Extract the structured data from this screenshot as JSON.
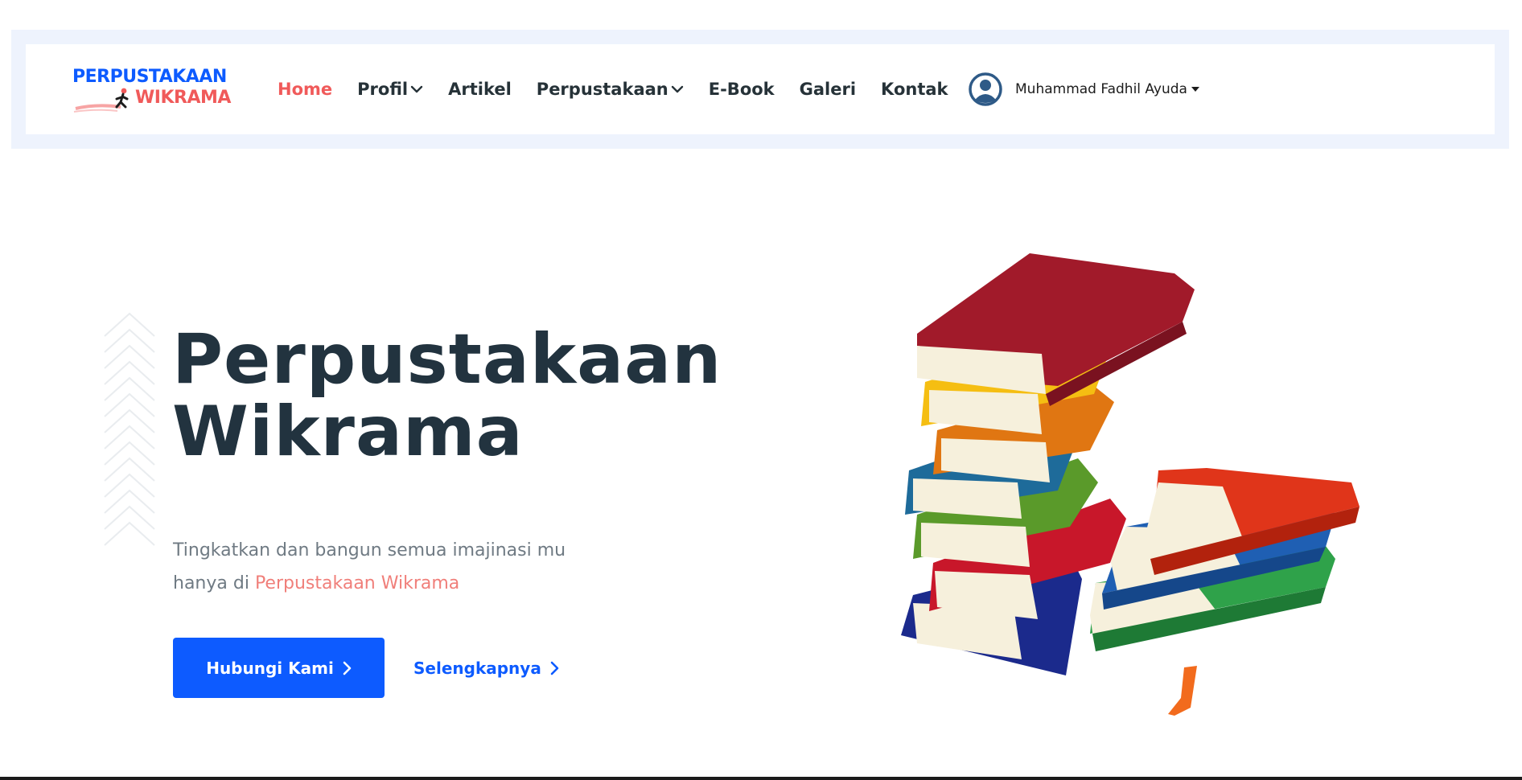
{
  "header": {
    "logo": {
      "line1": "PERPUSTAKAAN",
      "line2": "WIKRAMA"
    },
    "nav": [
      {
        "label": "Home",
        "active": true,
        "dropdown": false
      },
      {
        "label": "Profil",
        "active": false,
        "dropdown": true
      },
      {
        "label": "Artikel",
        "active": false,
        "dropdown": false
      },
      {
        "label": "Perpustakaan",
        "active": false,
        "dropdown": true
      },
      {
        "label": "E-Book",
        "active": false,
        "dropdown": false
      },
      {
        "label": "Galeri",
        "active": false,
        "dropdown": false
      },
      {
        "label": "Kontak",
        "active": false,
        "dropdown": false
      }
    ],
    "user": {
      "name": "Muhammad Fadhil Ayuda",
      "avatar_icon": "user-circle-icon"
    }
  },
  "hero": {
    "title_line1": "Perpustakaan",
    "title_line2": "Wikrama",
    "description_prefix": "Tingkatkan dan bangun semua imajinasi mu hanya di ",
    "description_highlight": "Perpustakaan Wikrama",
    "primary_button": "Hubungi Kami",
    "secondary_link": "Selengkapnya",
    "illustration_icon": "stacked-books-illustration"
  },
  "colors": {
    "brand_blue": "#0d5bff",
    "accent_red": "#f05a5a",
    "heading": "#22333f",
    "header_band": "#eef3fd"
  }
}
